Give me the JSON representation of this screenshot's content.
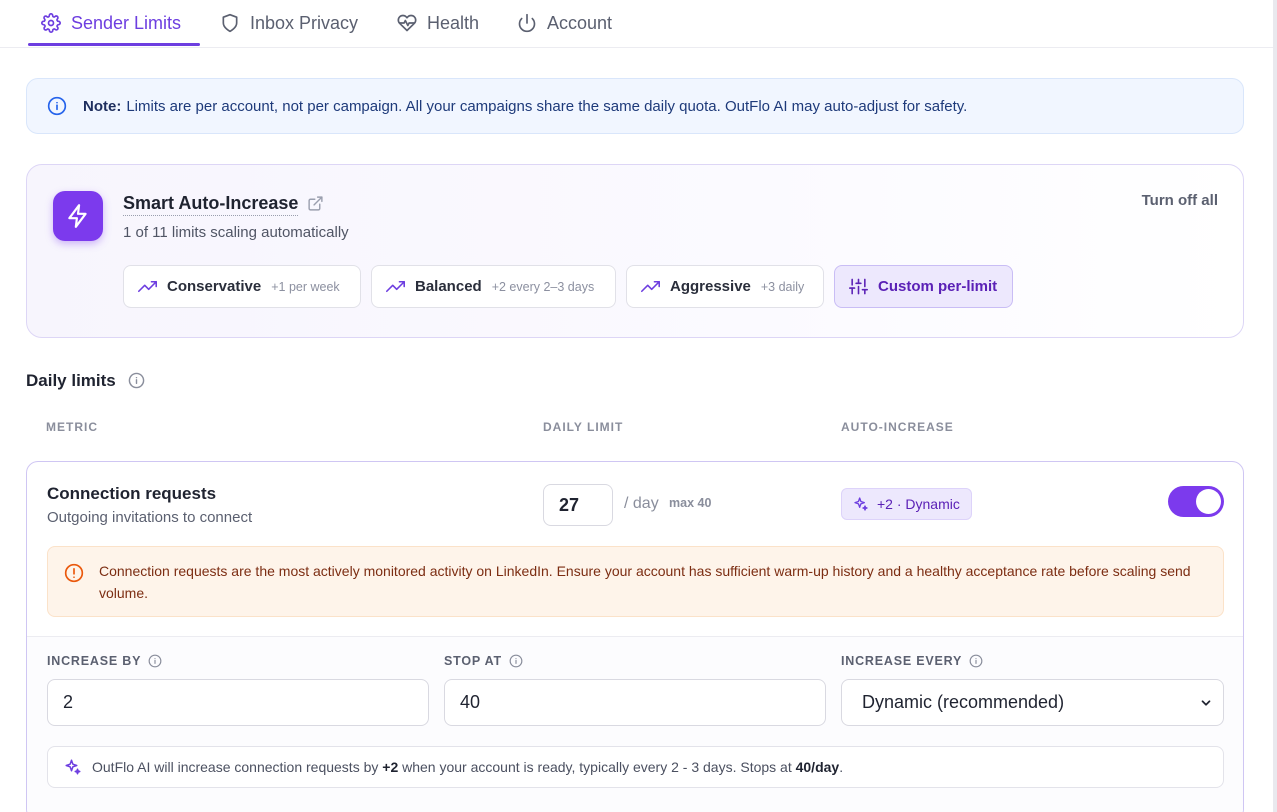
{
  "tabs": [
    {
      "label": "Sender Limits",
      "icon": "gear-icon",
      "active": true
    },
    {
      "label": "Inbox Privacy",
      "icon": "shield-icon",
      "active": false
    },
    {
      "label": "Health",
      "icon": "heart-pulse-icon",
      "active": false
    },
    {
      "label": "Account",
      "icon": "power-icon",
      "active": false
    }
  ],
  "note": {
    "prefix": "Note:",
    "text": "Limits are per account, not per campaign. All your campaigns share the same daily quota. OutFlo AI may auto-adjust for safety."
  },
  "smart": {
    "title": "Smart Auto-Increase",
    "subtitle": "1 of 11 limits scaling automatically",
    "turn_off": "Turn off all",
    "modes": [
      {
        "label": "Conservative",
        "hint": "+1 per week",
        "active": false
      },
      {
        "label": "Balanced",
        "hint": "+2 every 2–3 days",
        "active": false
      },
      {
        "label": "Aggressive",
        "hint": "+3 daily",
        "active": false
      },
      {
        "label": "Custom per-limit",
        "hint": "",
        "active": true
      }
    ]
  },
  "daily_limits": {
    "title": "Daily limits",
    "columns": {
      "metric": "METRIC",
      "daily_limit": "DAILY LIMIT",
      "auto_increase": "AUTO-INCREASE"
    }
  },
  "metric": {
    "title": "Connection requests",
    "subtitle": "Outgoing invitations to connect",
    "limit_value": "27",
    "per_day": "/ day",
    "max": "max 40",
    "badge": "+2 · Dynamic",
    "enabled": true,
    "warning": "Connection requests are the most actively monitored activity on LinkedIn. Ensure your account has sufficient warm-up history and a healthy acceptance rate before scaling send volume.",
    "increase_by": {
      "label": "INCREASE BY",
      "value": "2"
    },
    "stop_at": {
      "label": "STOP AT",
      "value": "40"
    },
    "increase_every": {
      "label": "INCREASE EVERY",
      "value": "Dynamic (recommended)"
    },
    "summary": {
      "t1": "OutFlo AI will increase connection requests by ",
      "inc": "+2",
      "t2": " when your account is ready, typically every 2 - 3 days. Stops at ",
      "stop": "40/day",
      "t3": "."
    }
  },
  "colors": {
    "accent": "#7c3aed",
    "note_bg": "#f1f6ff",
    "warn_bg": "#fef4ea",
    "warn_text": "#7c2d12"
  }
}
